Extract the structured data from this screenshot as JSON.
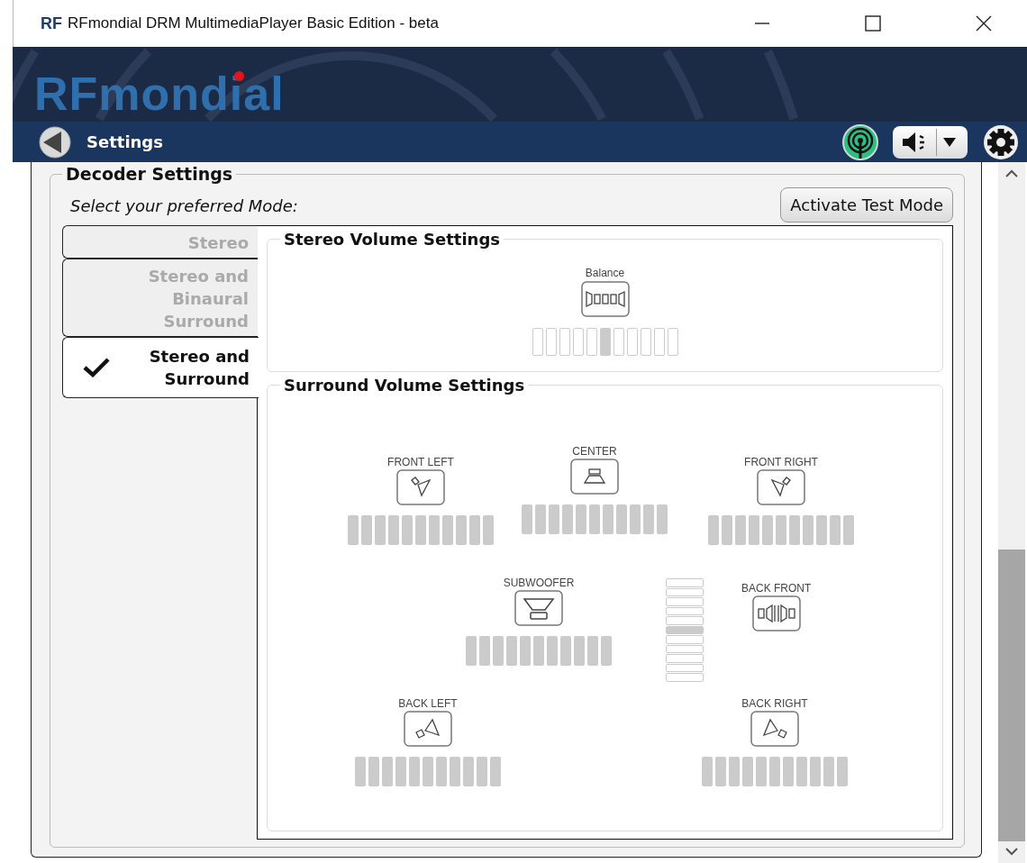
{
  "window": {
    "logo": "RF",
    "title": "RFmondial DRM MultimediaPlayer Basic Edition - beta"
  },
  "header": {
    "logo": "RFmondial"
  },
  "nav": {
    "title": "Settings"
  },
  "decoder": {
    "title": "Decoder Settings",
    "prompt": "Select your preferred Mode:",
    "test_button": "Activate Test Mode",
    "modes": [
      {
        "label": "Stereo",
        "selected": false
      },
      {
        "label": "Stereo and Binaural Surround",
        "selected": false
      },
      {
        "label": "Stereo and Surround",
        "selected": true
      }
    ],
    "stereo": {
      "title": "Stereo Volume Settings",
      "balance": {
        "label": "Balance",
        "level": 0.5
      }
    },
    "surround": {
      "title": "Surround Volume Settings",
      "speakers": [
        {
          "kind": "front-left",
          "label": "FRONT LEFT",
          "level": 1
        },
        {
          "kind": "center",
          "label": "CENTER",
          "level": 1
        },
        {
          "kind": "front-right",
          "label": "FRONT RIGHT",
          "level": 1
        },
        {
          "kind": "subwoofer",
          "label": "SUBWOOFER",
          "level": 1
        },
        {
          "kind": "back-left",
          "label": "BACK LEFT",
          "level": 1
        },
        {
          "kind": "back-right",
          "label": "BACK RIGHT",
          "level": 1
        }
      ],
      "back_front": {
        "label": "BACK FRONT",
        "level": 0.5
      }
    }
  }
}
